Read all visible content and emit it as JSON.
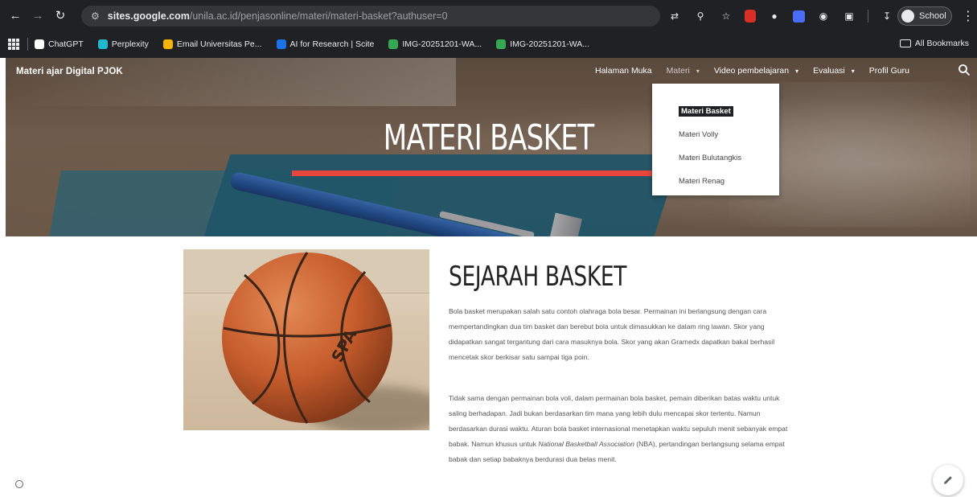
{
  "browser": {
    "url_domain": "sites.google.com",
    "url_path": "/unila.ac.id/penjasonline/materi/materi-basket?authuser=0",
    "profile_label": "School",
    "bookmarks": [
      {
        "label": "ChatGPT",
        "icon": "chatgpt-icon",
        "color": "#ffffff"
      },
      {
        "label": "Perplexity",
        "icon": "perplexity-icon",
        "color": "#20b8cd"
      },
      {
        "label": "Email Universitas Pe...",
        "icon": "email-icon",
        "color": "#f4b400"
      },
      {
        "label": "AI for Research | Scite",
        "icon": "scite-icon",
        "color": "#1a73e8"
      },
      {
        "label": "IMG-20251201-WA...",
        "icon": "image-icon",
        "color": "#34a853"
      },
      {
        "label": "IMG-20251201-WA...",
        "icon": "image-icon",
        "color": "#34a853"
      }
    ],
    "all_bookmarks_label": "All Bookmarks"
  },
  "site": {
    "title": "Materi ajar Digital PJOK",
    "nav": [
      {
        "label": "Halaman Muka",
        "has_caret": false,
        "active": false
      },
      {
        "label": "Materi",
        "has_caret": true,
        "active": true
      },
      {
        "label": "Video pembelajaran",
        "has_caret": true,
        "active": false
      },
      {
        "label": "Evaluasi",
        "has_caret": true,
        "active": false
      },
      {
        "label": "Profil Guru",
        "has_caret": false,
        "active": false
      }
    ],
    "dropdown": [
      {
        "label": "Materi Basket",
        "selected": true
      },
      {
        "label": "Materi Volly",
        "selected": false
      },
      {
        "label": "Materi Bulutangkis",
        "selected": false
      },
      {
        "label": "Materi Renag",
        "selected": false
      }
    ],
    "hero_title": "MATERI BASKET",
    "accent_color": "#e8453c"
  },
  "content": {
    "section_title": "SEJARAH BASKET",
    "paragraph1": "Bola basket merupakan salah satu contoh olahraga bola besar. Permainan ini berlangsung dengan cara mempertandingkan dua tim basket dan berebut bola untuk dimasukkan ke dalam ring lawan. Skor yang didapatkan sangat tergantung dari cara masuknya bola. Skor yang akan Gramedx dapatkan bakal berhasil mencetak skor berkisar satu sampai tiga poin.",
    "paragraph2_part1": "Tidak sama dengan permainan bola voli, dalam permainan bola basket, pemain diberikan batas waktu untuk saling berhadapan. Jadi bukan berdasarkan tim mana yang lebih dulu mencapai skor tertentu. Namun berdasarkan durasi waktu. Aturan bola basket internasional menetapkan waktu sepuluh menit sebanyak empat babak. Namun khusus untuk ",
    "paragraph2_italic": "National Basketball Association",
    "paragraph2_part2": " (NBA), pertandingan berlangsung selama empat babak dan setiap babaknya berdurasi dua belas menit."
  }
}
